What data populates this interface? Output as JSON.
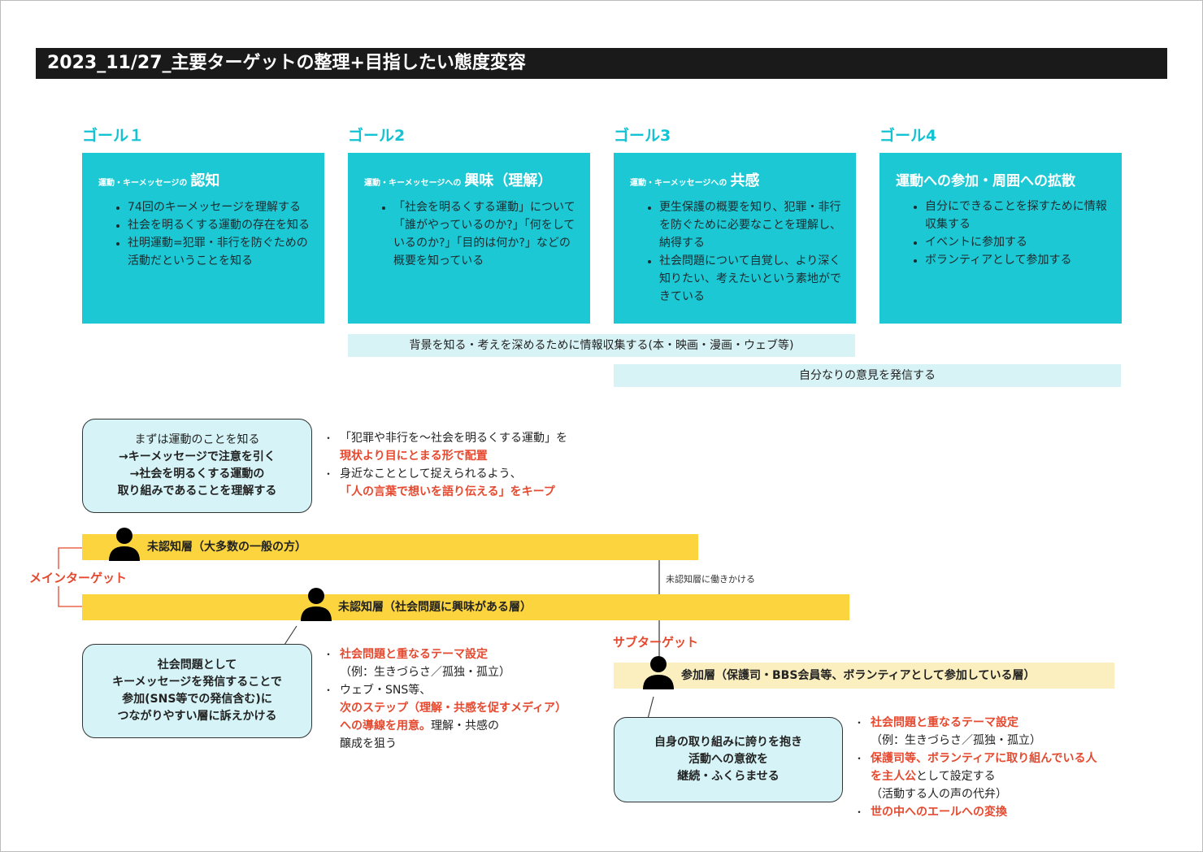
{
  "title": "2023_11/27_主要ターゲットの整理+目指したい態度変容",
  "goals": [
    {
      "label": "ゴール１",
      "head_small": "運動・キーメッセージの",
      "head_big": "認知",
      "items": [
        "74回のキーメッセージを理解する",
        "社会を明るくする運動の存在を知る",
        "社明運動=犯罪・非行を防ぐための活動だということを知る"
      ]
    },
    {
      "label": "ゴール2",
      "head_small": "運動・キーメッセージへの",
      "head_big": "興味（理解）",
      "items": [
        "「社会を明るくする運動」について「誰がやっているのか?」「何をしているのか?」「目的は何か?」などの概要を知っている"
      ]
    },
    {
      "label": "ゴール3",
      "head_small": "運動・キーメッセージへの",
      "head_big": "共感",
      "items": [
        "更生保護の概要を知り、犯罪・非行を防ぐために必要なことを理解し、納得する",
        "社会問題について自覚し、より深く知りたい、考えたいという素地ができている"
      ]
    },
    {
      "label": "ゴール4",
      "head_small": "",
      "head_big": "運動への参加・周囲への拡散",
      "items": [
        "自分にできることを探すために情報収集する",
        "イベントに参加する",
        "ボランティアとして参加する"
      ]
    }
  ],
  "strips": {
    "research": "背景を知る・考えを深めるために情報収集する(本・映画・漫画・ウェブ等)",
    "opinion": "自分なりの意見を発信する"
  },
  "callouts": {
    "first": [
      "まずは運動のことを知る",
      "→キーメッセージで注意を引く",
      "→社会を明るくする運動の",
      "取り組みであることを理解する"
    ],
    "second": [
      "社会問題として",
      "キーメッセージを発信することで",
      "参加(SNS等での発信含む)に",
      "つながりやすい層に訴えかける"
    ],
    "third": [
      "自身の取り組みに誇りを抱き",
      "活動への意欲を",
      "継続・ふくらませる"
    ]
  },
  "notes_first": {
    "item1_a": "「犯罪や非行を〜社会を明るくする運動」を",
    "item1_b": "現状より目にとまる形で配置",
    "item2_a": "身近なこととして捉えられるよう、",
    "item2_b": "「人の言葉で想いを語り伝える」をキープ"
  },
  "notes_second": {
    "item1_a": "社会問題と重なるテーマ設定",
    "item1_b": "（例：生きづらさ／孤独・孤立）",
    "item2_a": "ウェブ・SNS等、",
    "item2_b": "次のステップ（理解・共感を促すメディア）への導線を用意。",
    "item2_c": "理解・共感の",
    "item2_d": "醸成を狙う"
  },
  "notes_third": {
    "item1_a": "社会問題と重なるテーマ設定",
    "item1_b": "（例：生きづらさ／孤独・孤立）",
    "item2_a": "保護司等、ボランティアに取り組んでいる人を主人公",
    "item2_b": "として設定する",
    "item2_c": "（活動する人の声の代弁）",
    "item3_a": "世の中へのエールへの変換"
  },
  "layers": {
    "unaware_general": "未認知層（大多数の一般の方）",
    "unaware_interested": "未認知層（社会問題に興味がある層）",
    "participating": "参加層（保護司・BBS会員等、ボランティアとして参加している層）"
  },
  "labels": {
    "main_target": "メインターゲット",
    "sub_target": "サブターゲット",
    "reach_out": "未認知層に働きかける"
  },
  "colors": {
    "goal_cyan": "#1cc8d4",
    "goal_label": "#14c3d3",
    "strip_light": "#d8f3f6",
    "layer_yellow": "#fbd43e",
    "layer_light": "#fcefbf",
    "accent_red": "#e5492f"
  },
  "icons": [
    "person-icon"
  ]
}
